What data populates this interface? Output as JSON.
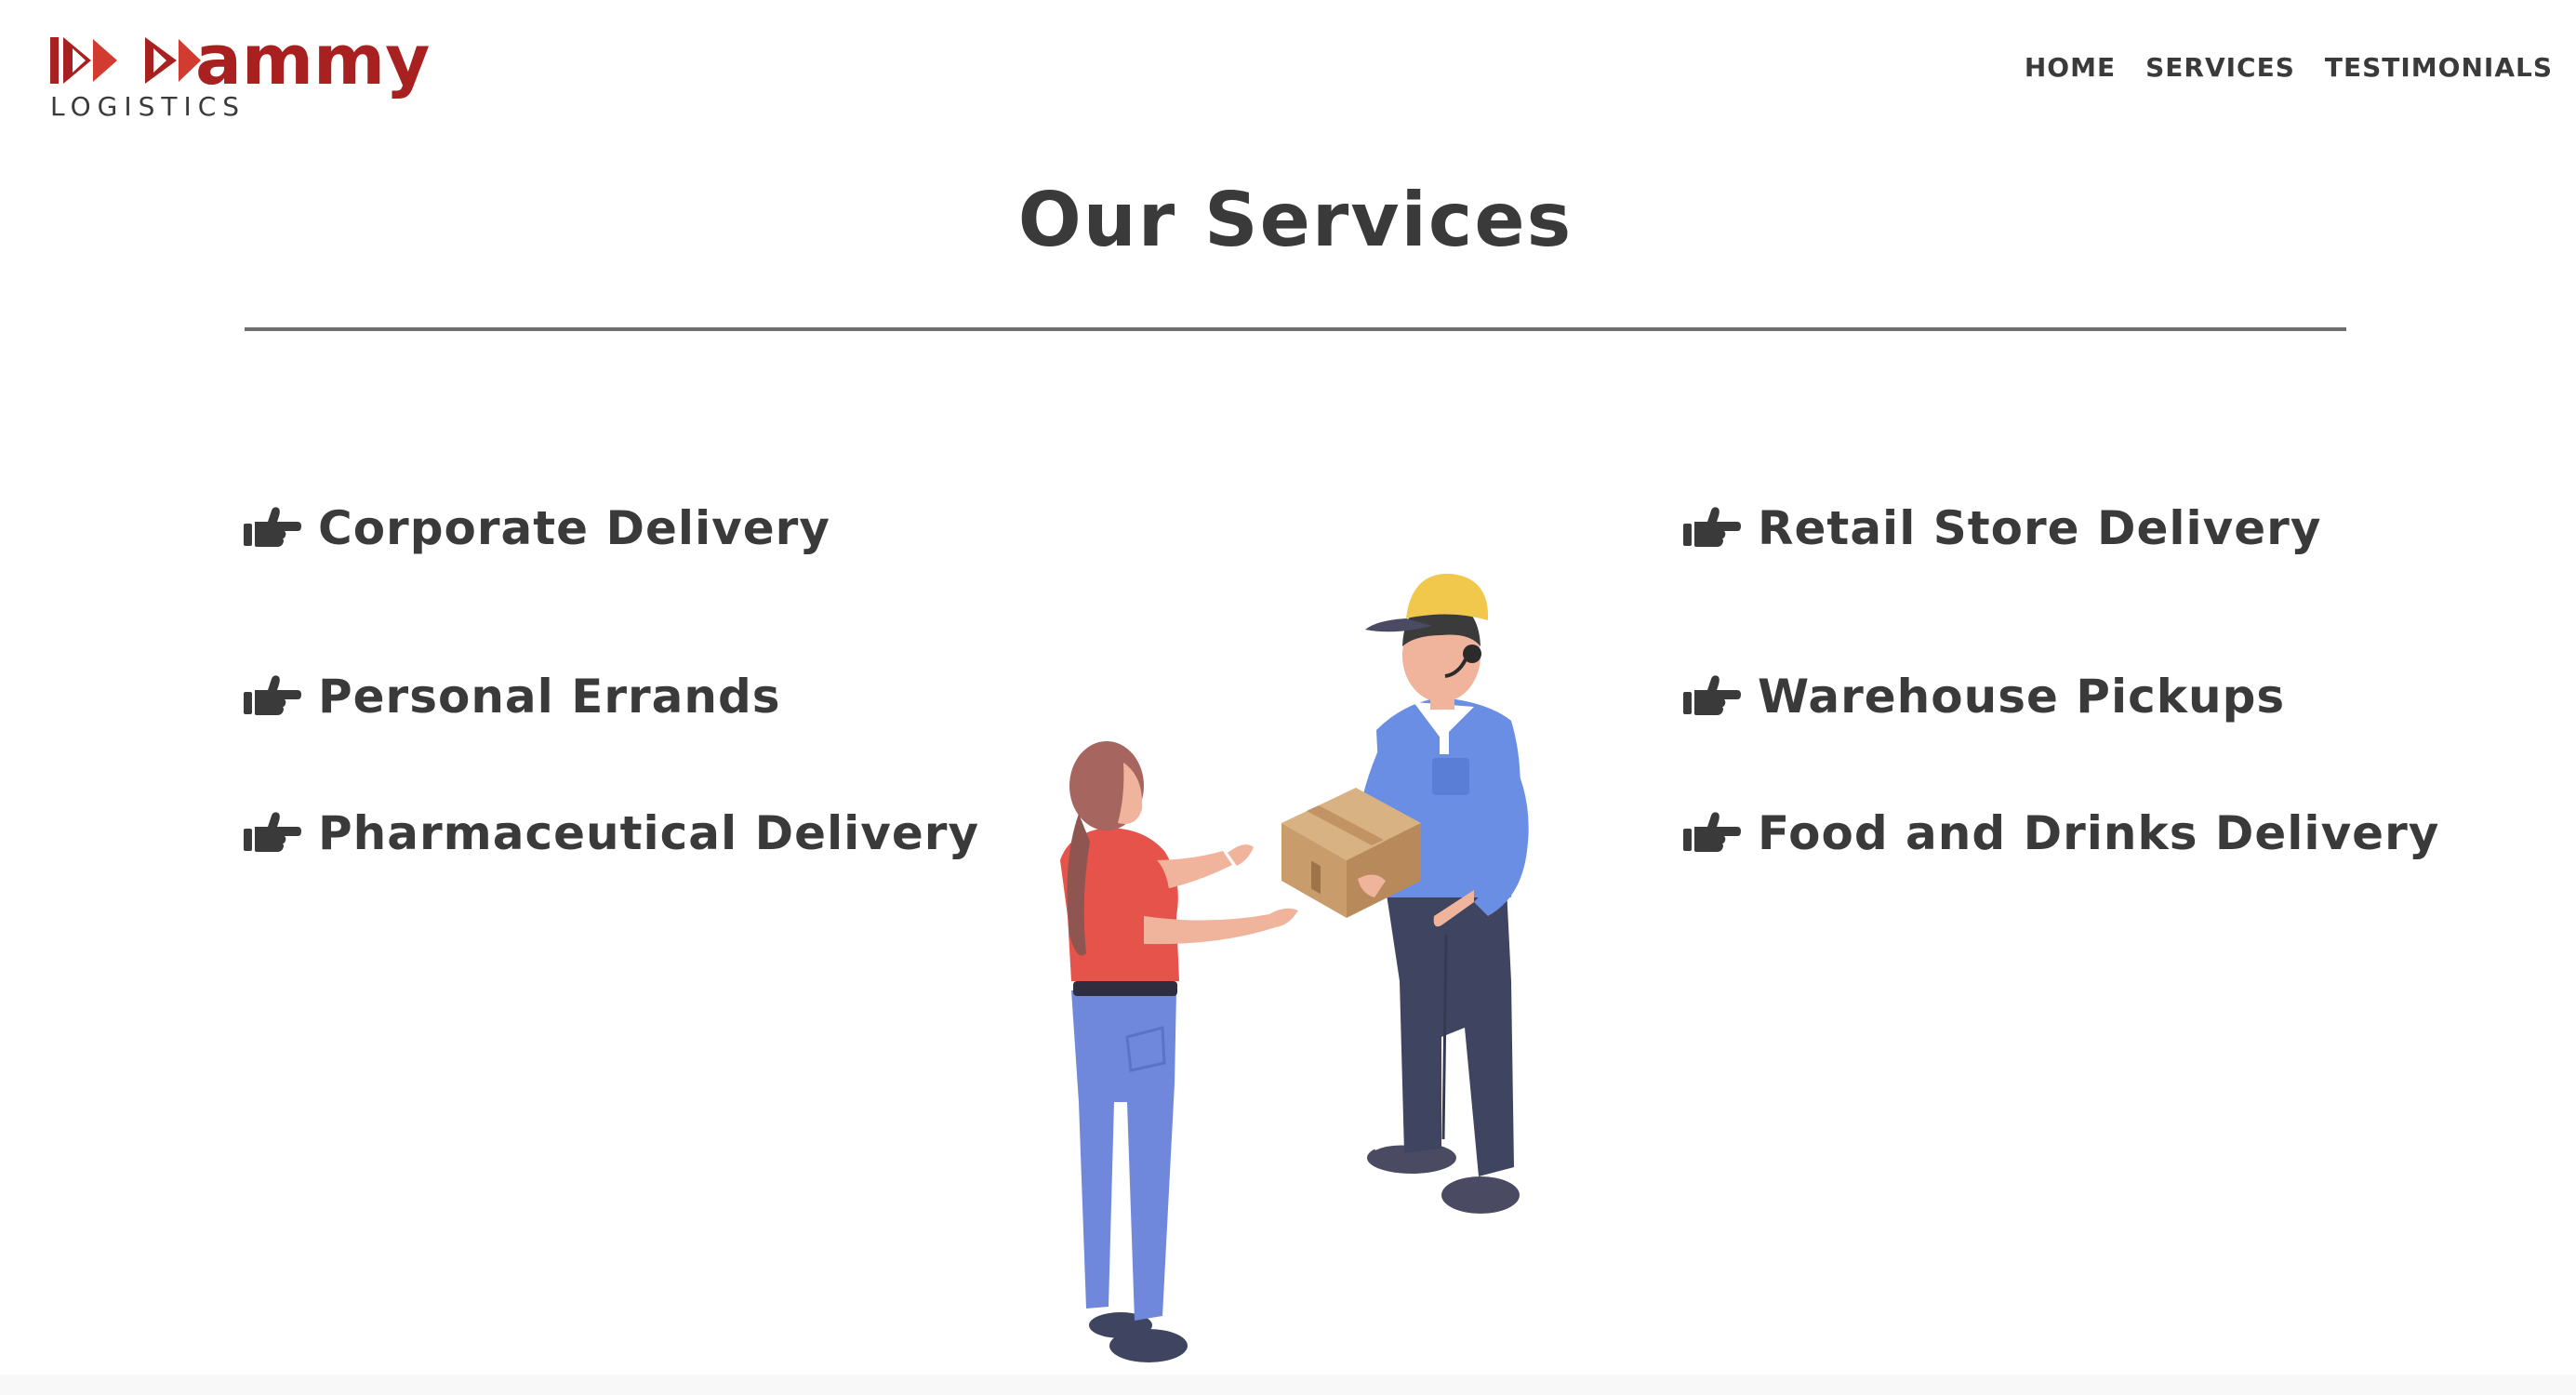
{
  "brand": {
    "name": "ammy",
    "tagline": "LOGISTICS",
    "color": "#a8201f"
  },
  "nav": {
    "items": [
      "HOME",
      "SERVICES",
      "TESTIMONIALS"
    ]
  },
  "services_section": {
    "title": "Our Services",
    "left": [
      "Corporate Delivery",
      "Personal Errands",
      "Pharmaceutical Delivery"
    ],
    "right": [
      "Retail Store Delivery",
      "Warehouse Pickups",
      "Food and Drinks Delivery"
    ],
    "bullet_icon": "hand-pointing-right-icon"
  },
  "colors": {
    "text": "#3a3a3a",
    "accent": "#a8201f"
  }
}
